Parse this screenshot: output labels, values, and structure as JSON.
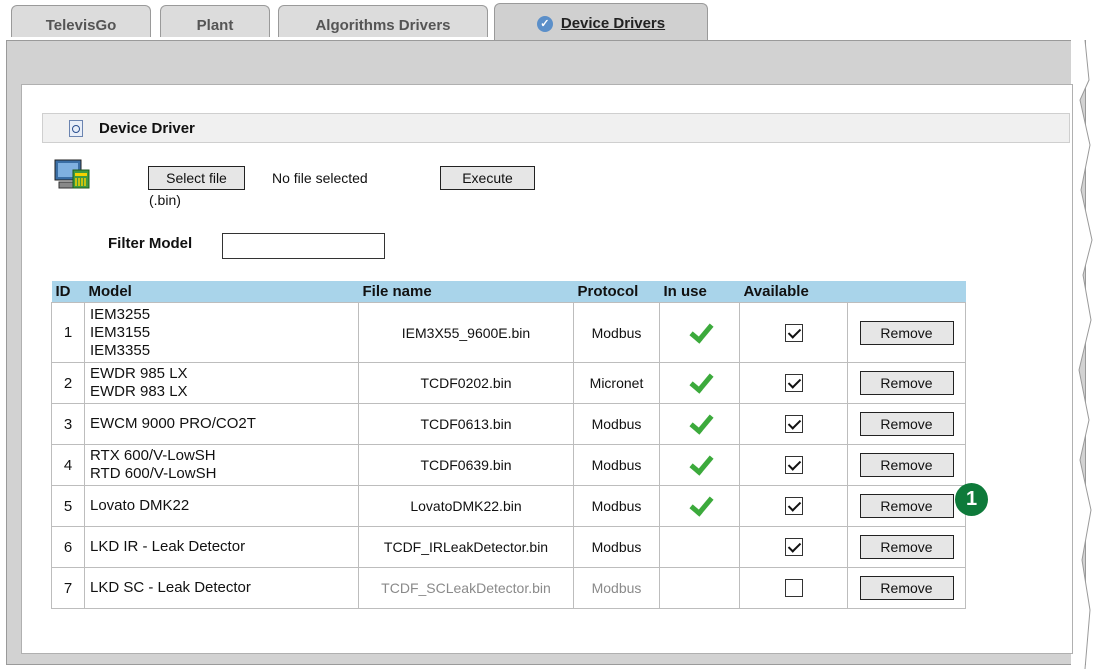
{
  "tabs": [
    {
      "label": "TelevisGo",
      "active": false
    },
    {
      "label": "Plant",
      "active": false
    },
    {
      "label": "Algorithms Drivers",
      "active": false
    },
    {
      "label": "Device Drivers",
      "active": true
    }
  ],
  "section": {
    "title": "Device Driver",
    "icon": "magnifier-document-icon"
  },
  "upload": {
    "select_label": "Select file",
    "file_status": "No file selected",
    "hint": "(.bin)",
    "execute_label": "Execute",
    "icon": "device-computer-icon"
  },
  "filter": {
    "label": "Filter Model",
    "value": ""
  },
  "table": {
    "headers": {
      "id": "ID",
      "model": "Model",
      "file": "File name",
      "protocol": "Protocol",
      "in_use": "In use",
      "available": "Available",
      "action": ""
    },
    "rows": [
      {
        "id": "1",
        "models": [
          "IEM3255",
          "IEM3155",
          "IEM3355"
        ],
        "file": "IEM3X55_9600E.bin",
        "protocol": "Modbus",
        "in_use": true,
        "available": true,
        "action": "Remove",
        "dimmed": false
      },
      {
        "id": "2",
        "models": [
          "EWDR 985 LX",
          "EWDR 983 LX"
        ],
        "file": "TCDF0202.bin",
        "protocol": "Micronet",
        "in_use": true,
        "available": true,
        "action": "Remove",
        "dimmed": false
      },
      {
        "id": "3",
        "models": [
          "EWCM 9000 PRO/CO2T"
        ],
        "file": "TCDF0613.bin",
        "protocol": "Modbus",
        "in_use": true,
        "available": true,
        "action": "Remove",
        "dimmed": false
      },
      {
        "id": "4",
        "models": [
          "RTX 600/V-LowSH",
          "RTD 600/V-LowSH"
        ],
        "file": "TCDF0639.bin",
        "protocol": "Modbus",
        "in_use": true,
        "available": true,
        "action": "Remove",
        "dimmed": false
      },
      {
        "id": "5",
        "models": [
          "Lovato DMK22"
        ],
        "file": "LovatoDMK22.bin",
        "protocol": "Modbus",
        "in_use": true,
        "available": true,
        "action": "Remove",
        "dimmed": false
      },
      {
        "id": "6",
        "models": [
          "LKD IR - Leak Detector"
        ],
        "file": "TCDF_IRLeakDetector.bin",
        "protocol": "Modbus",
        "in_use": false,
        "available": true,
        "action": "Remove",
        "dimmed": false
      },
      {
        "id": "7",
        "models": [
          "LKD SC - Leak Detector"
        ],
        "file": "TCDF_SCLeakDetector.bin",
        "protocol": "Modbus",
        "in_use": false,
        "available": false,
        "action": "Remove",
        "dimmed": true
      }
    ]
  },
  "callout": {
    "number": "1"
  },
  "colors": {
    "header_bg": "#a9d4ea",
    "check_green": "#3caa3c",
    "callout": "#0e7a3a",
    "tab_check": "#5b8fc9"
  }
}
